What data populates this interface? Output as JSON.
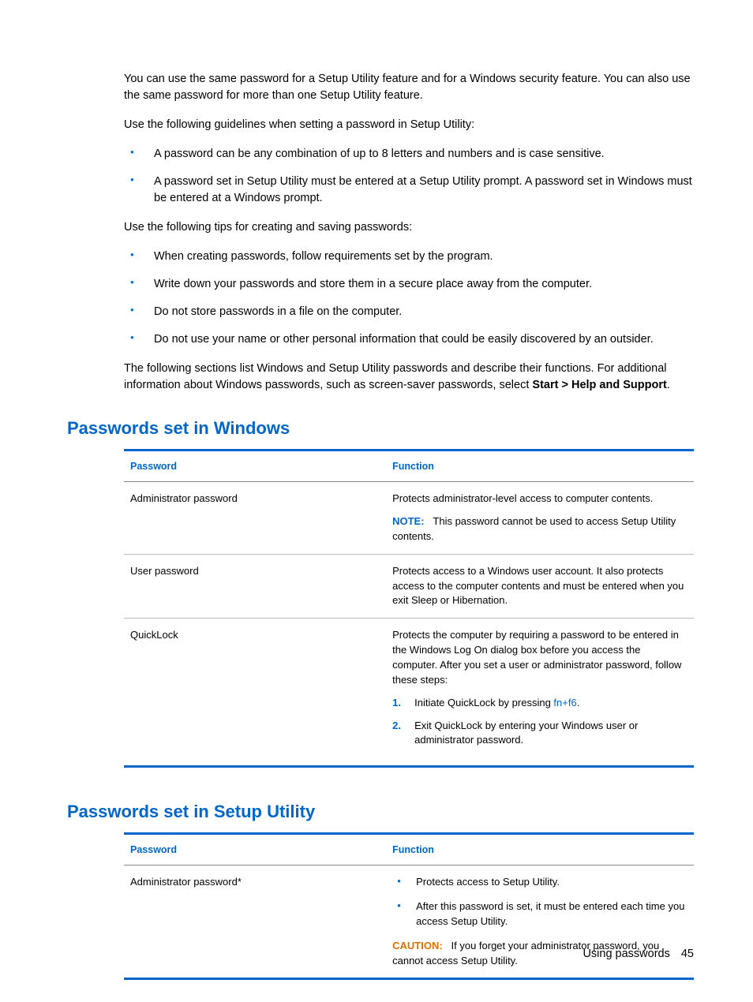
{
  "intro": {
    "p1": "You can use the same password for a Setup Utility feature and for a Windows security feature. You can also use the same password for more than one Setup Utility feature.",
    "p2": "Use the following guidelines when setting a password in Setup Utility:",
    "guidelines": [
      "A password can be any combination of up to 8 letters and numbers and is case sensitive.",
      "A password set in Setup Utility must be entered at a Setup Utility prompt. A password set in Windows must be entered at a Windows prompt."
    ],
    "p3": "Use the following tips for creating and saving passwords:",
    "tips": [
      "When creating passwords, follow requirements set by the program.",
      "Write down your passwords and store them in a secure place away from the computer.",
      "Do not store passwords in a file on the computer.",
      "Do not use your name or other personal information that could be easily discovered by an outsider."
    ],
    "p4_a": "The following sections list Windows and Setup Utility passwords and describe their functions. For additional information about Windows passwords, such as screen-saver passwords, select ",
    "p4_b": "Start > Help and Support",
    "p4_c": "."
  },
  "section1": {
    "heading": "Passwords set in Windows",
    "headers": {
      "col1": "Password",
      "col2": "Function"
    },
    "rows": {
      "r1": {
        "name": "Administrator password",
        "func": "Protects administrator-level access to computer contents.",
        "note_label": "NOTE:",
        "note_text": "This password cannot be used to access Setup Utility contents."
      },
      "r2": {
        "name": "User password",
        "func": "Protects access to a Windows user account. It also protects access to the computer contents and must be entered when you exit Sleep or Hibernation."
      },
      "r3": {
        "name": "QuickLock",
        "func": "Protects the computer by requiring a password to be entered in the Windows Log On dialog box before you access the computer. After you set a user or administrator password, follow these steps:",
        "step1_a": "Initiate QuickLock by pressing ",
        "step1_b": "fn+f6",
        "step1_c": ".",
        "step2": "Exit QuickLock by entering your Windows user or administrator password."
      }
    }
  },
  "section2": {
    "heading": "Passwords set in Setup Utility",
    "headers": {
      "col1": "Password",
      "col2": "Function"
    },
    "rows": {
      "r1": {
        "name": "Administrator password*",
        "b1": "Protects access to Setup Utility.",
        "b2": "After this password is set, it must be entered each time you access Setup Utility.",
        "caution_label": "CAUTION:",
        "caution_text": "If you forget your administrator password, you cannot access Setup Utility."
      }
    }
  },
  "footer": {
    "label": "Using passwords",
    "page": "45"
  }
}
